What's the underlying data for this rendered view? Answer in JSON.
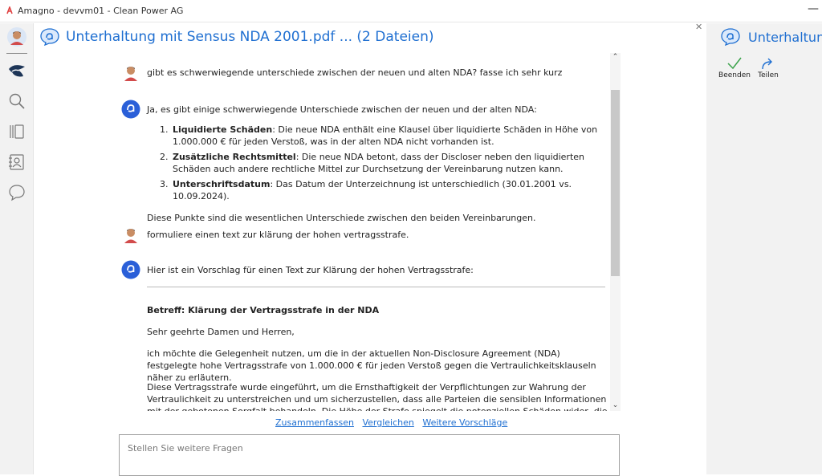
{
  "window": {
    "title": "Amagno - devvm01 - Clean Power AG"
  },
  "header": {
    "title": "Unterhaltung mit Sensus NDA 2001.pdf ... (2 Dateien)"
  },
  "messages": {
    "m1": "gibt es schwerwiegende unterschiede zwischen der neuen und alten NDA? fasse ich sehr kurz",
    "m2_intro": "Ja, es gibt einige schwerwiegende Unterschiede zwischen der neuen und der alten NDA:",
    "m2_items": [
      {
        "bold": "Liquidierte Schäden",
        "text": ": Die neue NDA enthält eine Klausel über liquidierte Schäden in Höhe von 1.000.000 € für jeden Verstoß, was in der alten NDA nicht vorhanden ist."
      },
      {
        "bold": "Zusätzliche Rechtsmittel",
        "text": ": Die neue NDA betont, dass der Discloser neben den liquidierten Schäden auch andere rechtliche Mittel zur Durchsetzung der Vereinbarung nutzen kann."
      },
      {
        "bold": "Unterschriftsdatum",
        "text": ": Das Datum der Unterzeichnung ist unterschiedlich (30.01.2001 vs. 10.09.2024)."
      }
    ],
    "m2_outro": "Diese Punkte sind die wesentlichen Unterschiede zwischen den beiden Vereinbarungen.",
    "m3": "formuliere einen text zur klärung der hohen vertragsstrafe.",
    "m4_intro": "Hier ist ein Vorschlag für einen Text zur Klärung der hohen Vertragsstrafe:",
    "m4_subject": "Betreff: Klärung der Vertragsstrafe in der NDA",
    "m4_greeting": "Sehr geehrte Damen und Herren,",
    "m4_p1": "ich möchte die Gelegenheit nutzen, um die in der aktuellen Non-Disclosure Agreement (NDA) festgelegte hohe Vertragsstrafe von 1.000.000 € für jeden Verstoß gegen die Vertraulichkeitsklauseln näher zu erläutern.",
    "m4_p2": "Diese Vertragsstrafe wurde eingeführt, um die Ernsthaftigkeit der Verpflichtungen zur Wahrung der Vertraulichkeit zu unterstreichen und um sicherzustellen, dass alle Parteien die sensiblen Informationen mit der gebotenen Sorgfalt behandeln. Die Höhe der Strafe spiegelt die potenziellen Schäden wider, die durch eine unbefugte Offenlegung oder Nutzung vertraulicher"
  },
  "actions": {
    "summarize": "Zusammenfassen",
    "compare": "Vergleichen",
    "more": "Weitere Vorschläge"
  },
  "input": {
    "placeholder": "Stellen Sie weitere Fragen"
  },
  "right_panel": {
    "title": "Unterhaltung",
    "end_label": "Beenden",
    "share_label": "Teilen"
  },
  "icons": {
    "app": "amagno-logo-icon",
    "user": "user-avatar-icon",
    "bot": "sensus-assistant-icon",
    "nav": [
      "user-avatar-icon",
      "bird-logo-icon",
      "search-icon",
      "library-icon",
      "contacts-icon",
      "chat-icon"
    ],
    "end": "checkmark-icon",
    "share": "share-arrow-icon",
    "close": "close-icon"
  },
  "colors": {
    "accent": "#1f6fd1",
    "bot_badge": "#2a5fd8",
    "end_check": "#3aa24a"
  }
}
